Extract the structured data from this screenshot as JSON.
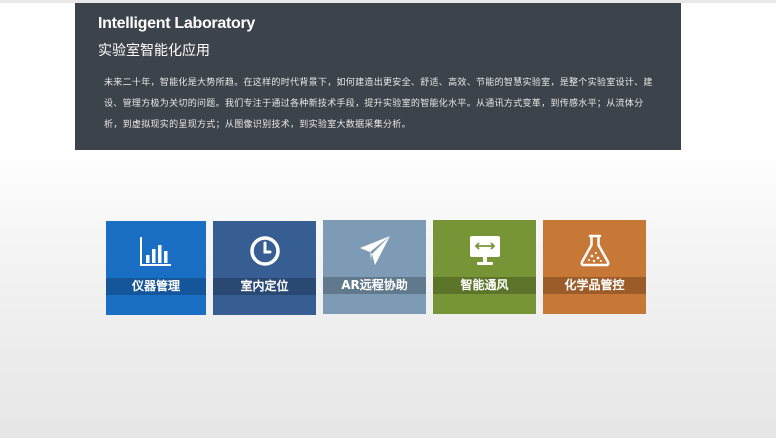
{
  "banner": {
    "title_en": "Intelligent Laboratory",
    "title_cn": "实验室智能化应用",
    "description": "未来二十年，智能化是大势所趋。在这样的时代背景下，如何建造出更安全、舒适、高效、节能的智慧实验室，是整个实验室设计、建设、管理方极为关切的问题。我们专注于通过各种新技术手段，提升实验室的智能化水平。从通讯方式变革，到传感水平；从流体分析，到虚拟现实的呈现方式；从图像识别技术，到实验室大数据采集分析。"
  },
  "tiles": [
    {
      "label": "仪器管理",
      "icon": "bar-chart-icon",
      "color": "#1a6fc4"
    },
    {
      "label": "室内定位",
      "icon": "clock-icon",
      "color": "#365e92"
    },
    {
      "label": "AR远程协助",
      "icon": "paper-plane-icon",
      "color": "#7d9bb5"
    },
    {
      "label": "智能通风",
      "icon": "monitor-icon",
      "color": "#779537"
    },
    {
      "label": "化学品管控",
      "icon": "flask-icon",
      "color": "#c77736"
    }
  ]
}
